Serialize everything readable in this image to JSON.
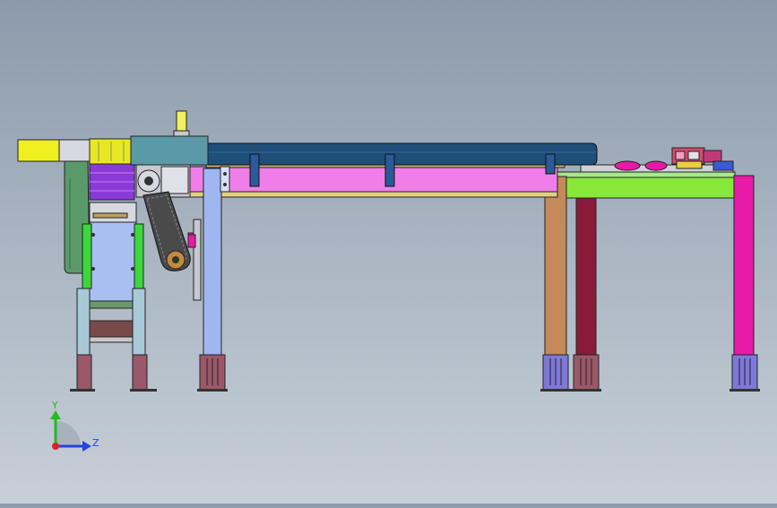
{
  "triad": {
    "y_label": "Y",
    "z_label": "Z",
    "y_color": "#22bb22",
    "z_color": "#2244dd",
    "origin_color": "#dd2222"
  },
  "palette": {
    "background_top": "#8c9aab",
    "background_bottom": "#c7cfd8",
    "conveyor_belt": "#1f4f78",
    "conveyor_frame": "#f07ee8",
    "table_top": "#88e83a",
    "leg_brown": "#c48a5a",
    "leg_maroon": "#8a1a3a",
    "leg_magenta": "#e81aa8",
    "leg_blue": "#9fb6f0",
    "foot_pad": "#9a5868",
    "foot_pad_blue": "#7e78d8",
    "hopper_yellow": "#f0f020",
    "body_green": "#5a9a6a",
    "plate_blue": "#a9bff2",
    "roller_purple": "#8a3ad8",
    "side_green": "#3ad83a"
  }
}
